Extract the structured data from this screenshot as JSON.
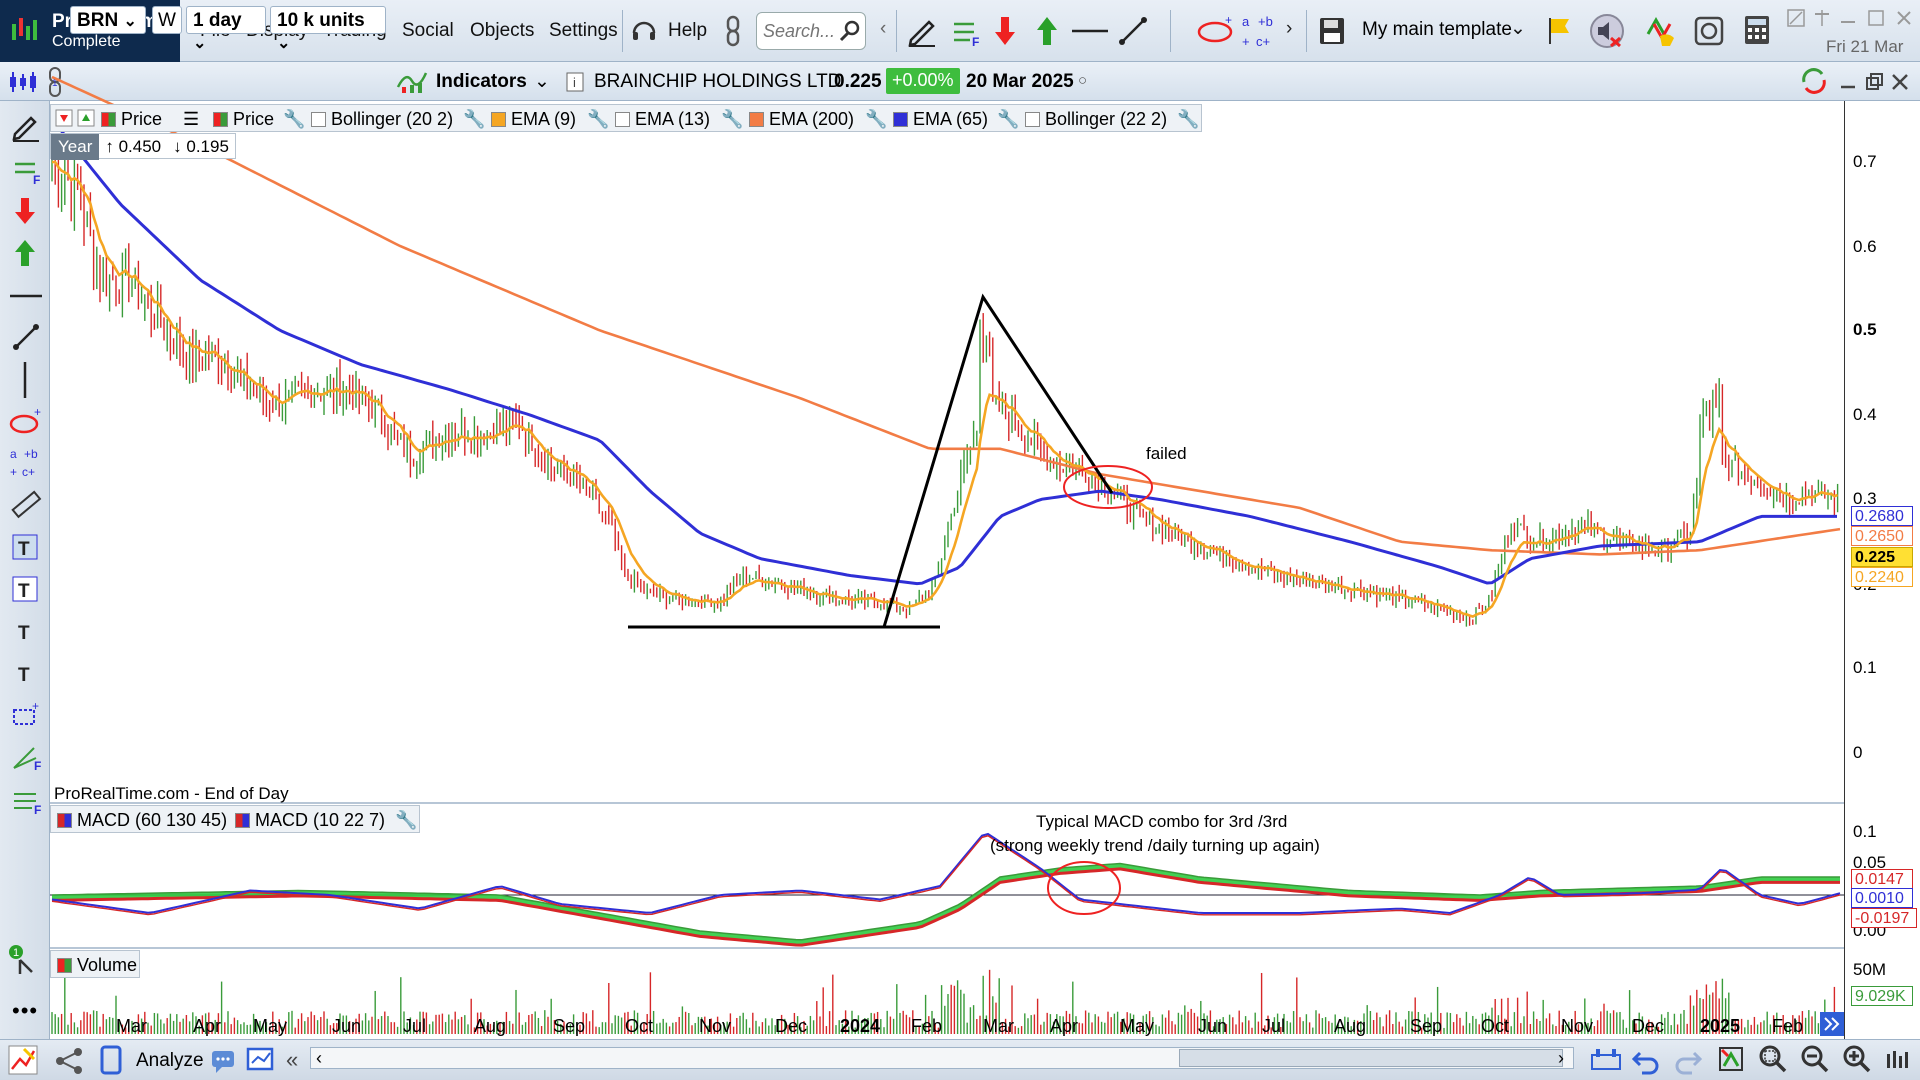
{
  "app": {
    "name": "ProRealTime",
    "edition": "Complete"
  },
  "menu": [
    "File",
    "Display",
    "Trading",
    "Social",
    "Objects",
    "Settings",
    "Help"
  ],
  "search": {
    "placeholder": "Search..."
  },
  "template": {
    "label": "My main template"
  },
  "clock": {
    "date": "Fri 21 Mar"
  },
  "chart_bar": {
    "ticker": "BRN",
    "period": "1 day",
    "units": "10 k units",
    "indicators": "Indicators",
    "instrument": "BRAINCHIP HOLDINGS LTD",
    "last": "0.225",
    "change": "+0.00%",
    "date": "20 Mar 2025",
    "w": "W"
  },
  "legend": [
    {
      "label": "Price",
      "color": "#3a9b3a"
    },
    {
      "label": "Price",
      "color": "#3a9b3a"
    },
    {
      "label": "Bollinger (20 2)",
      "color": "#ffffff"
    },
    {
      "label": "EMA (9)",
      "color": "#f5a623"
    },
    {
      "label": "EMA (13)",
      "color": "#ffffff"
    },
    {
      "label": "EMA (200)",
      "color": "#f27c45"
    },
    {
      "label": "EMA (65)",
      "color": "#2f2fd6"
    },
    {
      "label": "Bollinger (22 2)",
      "color": "#ffffff"
    }
  ],
  "year_box": {
    "label": "Year",
    "high": "0.450",
    "low": "0.195"
  },
  "source_note": "ProRealTime.com - End of Day",
  "annotations": {
    "failed": "failed",
    "macd_note_1": "Typical MACD combo for 3rd /3rd",
    "macd_note_2": "(strong weekly trend /daily turning up again)"
  },
  "macd_legend": [
    "MACD (60 130 45)",
    "MACD (10 22 7)"
  ],
  "volume_legend": "Volume",
  "price_axis": [
    "0.7",
    "0.6",
    "0.5",
    "0.4",
    "0.3",
    "0.2",
    "0.1",
    "0"
  ],
  "price_tags": [
    {
      "text": "0.2680",
      "color": "#2f2fd6",
      "bg": "#ffffff"
    },
    {
      "text": "0.2650",
      "color": "#f27c45",
      "bg": "#ffffff"
    },
    {
      "text": "0.225",
      "color": "#000000",
      "bg": "#ffe033"
    },
    {
      "text": "0.2240",
      "color": "#f5a623",
      "bg": "#ffffff"
    }
  ],
  "macd_axis": [
    "0.1",
    "0.05",
    "0.00"
  ],
  "macd_tags": [
    {
      "text": "0.0147",
      "color": "#d62728",
      "bg": "#ffffff"
    },
    {
      "text": "0.0010",
      "color": "#2f2fd6",
      "bg": "#ffffff"
    },
    {
      "text": "-0.0197",
      "color": "#d62728",
      "bg": "#ffffff"
    }
  ],
  "volume_axis": {
    "tick": "50M",
    "last": "9.029K"
  },
  "x_axis": [
    "Mar",
    "Apr",
    "May",
    "Jun",
    "Jul",
    "Aug",
    "Sep",
    "Oct",
    "Nov",
    "Dec",
    "2024",
    "Feb",
    "Mar",
    "Apr",
    "May",
    "Jun",
    "Jul",
    "Aug",
    "Sep",
    "Oct",
    "Nov",
    "Dec",
    "2025",
    "Feb"
  ],
  "bottom": {
    "analyze": "Analyze"
  },
  "colors": {
    "ema9": "#f5a623",
    "ema65": "#2f2fd6",
    "ema200": "#f27c45",
    "bull": "#3a9b3a",
    "bear": "#d62728",
    "macd_fill": "#2ecc40"
  }
}
